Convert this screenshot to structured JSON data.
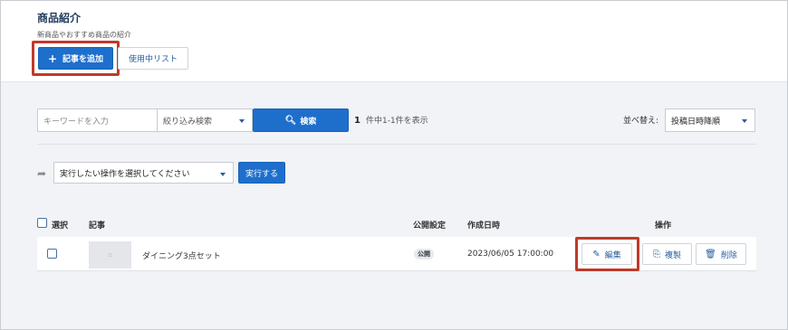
{
  "header": {
    "title": "商品紹介",
    "subtitle": "新商品やおすすめ商品の紹介",
    "add_button": "記事を追加",
    "list_button": "使用中リスト"
  },
  "search": {
    "keyword_placeholder": "キーワードを入力",
    "filter_label": "絞り込み検索",
    "search_button": "検索",
    "result_total": "1",
    "result_text": "件中1-1件を表示",
    "sort_label": "並べ替え:",
    "sort_value": "投稿日時降順"
  },
  "bulk": {
    "action_placeholder": "実行したい操作を選択してください",
    "run_button": "実行する"
  },
  "table": {
    "headers": {
      "select": "選択",
      "article": "記事",
      "publish": "公開設定",
      "created": "作成日時",
      "actions": "操作"
    },
    "rows": [
      {
        "title": "ダイニング3点セット",
        "status": "公開",
        "created": "2023/06/05 17:00:00",
        "edit": "編集",
        "copy": "複製",
        "delete": "削除"
      }
    ]
  },
  "colors": {
    "primary": "#1e6fcc",
    "highlight": "#c0392b",
    "link": "#2a5d9f"
  }
}
